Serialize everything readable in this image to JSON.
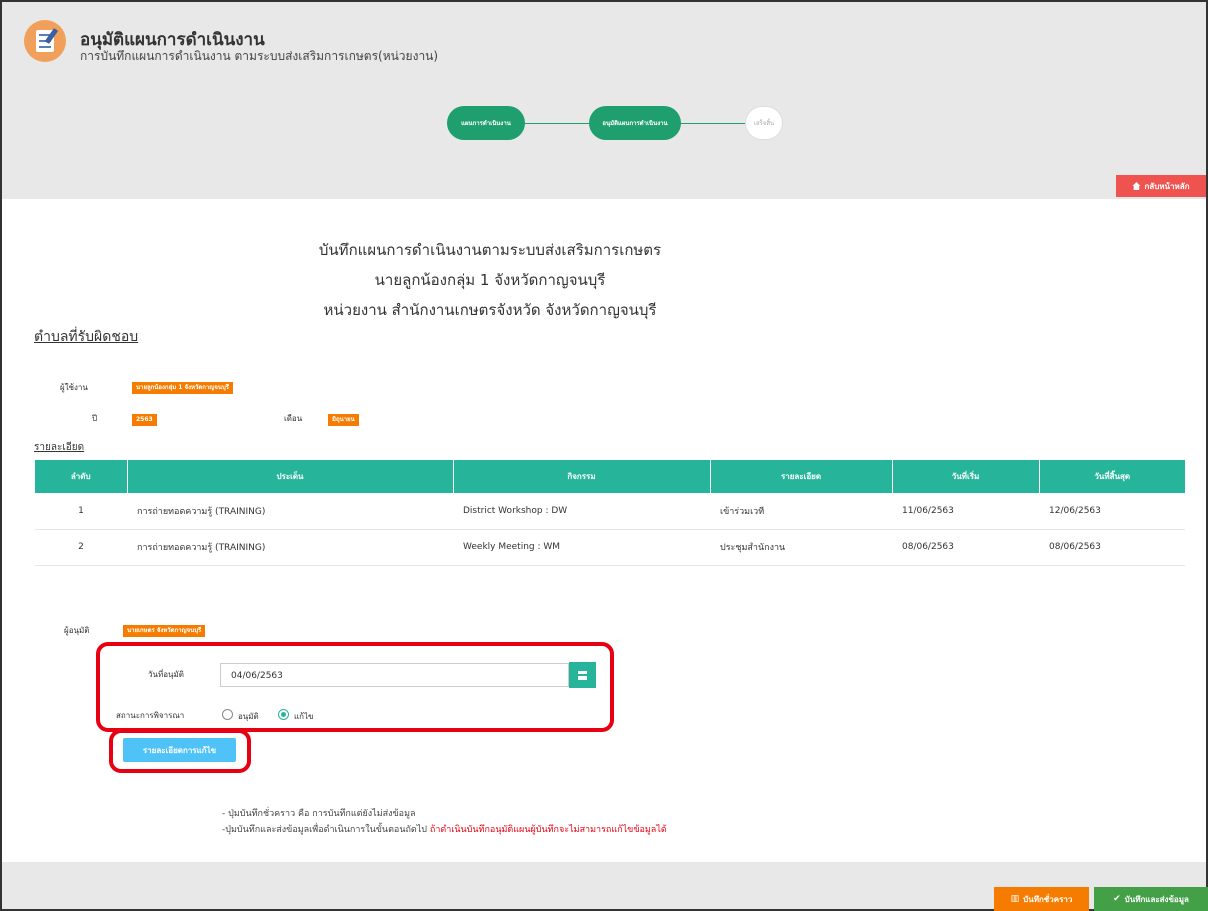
{
  "header": {
    "title": "อนุมัติแผนการดำเนินงาน",
    "subtitle": "การบันทึกแผนการดำเนินงาน ตามระบบส่งเสริมการเกษตร(หน่วยงาน)"
  },
  "stepper": {
    "steps": [
      {
        "label": "แผนการดำเนินงาน",
        "state": "active"
      },
      {
        "label": "อนุมัติแผนการดำเนินงาน",
        "state": "active"
      },
      {
        "label": "เสร็จสิ้น",
        "state": "inactive"
      }
    ]
  },
  "home_button": {
    "label": "กลับหน้าหลัก",
    "icon": "home-icon",
    "color": "#ef5350"
  },
  "report": {
    "line1": "บันทึกแผนการดำเนินงานตามระบบส่งเสริมการเกษตร",
    "line2": "นายลูกน้องกลุ่ม 1 จังหวัดกาญจนบุรี",
    "line3": "หน่วยงาน สำนักงานเกษตรจังหวัด จังหวัดกาญจนบุรี"
  },
  "section_title": "ตำบลที่รับผิดชอบ",
  "user_info": {
    "user_label": "ผู้ใช้งาน",
    "user_value": "นายลูกน้องกลุ่ม 1 จังหวัดกาญจนบุรี",
    "year_label": "ปี",
    "year_value": "2563",
    "month_label": "เดือน",
    "month_value": "มิถุนายน"
  },
  "details_title": "รายละเอียด",
  "table": {
    "headers": [
      "ลำดับ",
      "ประเด็น",
      "กิจกรรม",
      "รายละเอียด",
      "วันที่เริ่ม",
      "วันที่สิ้นสุด"
    ],
    "rows": [
      [
        "1",
        "การถ่ายทอดความรู้ (TRAINING)",
        "District Workshop : DW",
        "เข้าร่วมเวที",
        "11/06/2563",
        "12/06/2563"
      ],
      [
        "2",
        "การถ่ายทอดความรู้ (TRAINING)",
        "Weekly Meeting : WM",
        "ประชุมสำนักงาน",
        "08/06/2563",
        "08/06/2563"
      ]
    ],
    "header_color": "#26b59a"
  },
  "approval": {
    "approver_label": "ผู้อนุมัติ",
    "approver_value": "นายเกษตร จังหวัดกาญจนบุรี",
    "date_label": "วันที่อนุมัติ",
    "date_value": "04/06/2563",
    "status_label": "สถานะการพิจารณา",
    "option_approve": "อนุมัติ",
    "option_edit": "แก้ไข",
    "selected": "แก้ไข",
    "detail_button": "รายละเอียดการแก้ไข"
  },
  "notes": {
    "note1": "- ปุ่มบันทึกชั่วคราว คือ การบันทึกแต่ยังไม่ส่งข้อมูล",
    "note2_prefix": "-ปุ่มบันทึกและส่งข้อมูลเพื่อดำเนินการในขั้นตอนถัดไป",
    "note2_warning": "ถ้าดำเนินบันทึกอนุมัติแผนผู้บันทึกจะไม่สามารถแก้ไขข้อมูลได้"
  },
  "footer": {
    "draft_button": "บันทึกชั่วคราว",
    "send_button": "บันทึกและส่งข้อมูล",
    "draft_color": "#f57c00",
    "send_color": "#43a047"
  }
}
